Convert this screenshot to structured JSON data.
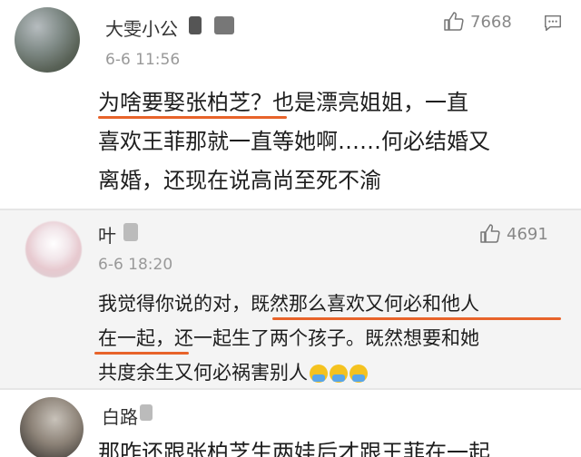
{
  "comments": [
    {
      "username": "大雯小公",
      "time": "6-6 11:56",
      "likes": "7668",
      "lines": [
        "为啥要娶张柏芝？也是漂亮姐姐，一直",
        "喜欢王菲那就一直等她啊……何必结婚又",
        "离婚，还现在说高尚至死不渝"
      ]
    },
    {
      "username": "叶",
      "time": "6-6 18:20",
      "likes": "4691",
      "lines": [
        "我觉得你说的对，既然那么喜欢又何必和他人",
        "在一起，还一起生了两个孩子。既然想要和她",
        "共度余生又何必祸害别人"
      ]
    },
    {
      "username": "白路",
      "lines": [
        "那咋还跟张柏芝生两娃后才跟王菲在一起"
      ]
    }
  ],
  "colors": {
    "underline": "#e8632a",
    "meta": "#999999",
    "like": "#888888"
  },
  "icons": {
    "like": "thumbs-up-icon",
    "reply": "reply-icon",
    "emoji": "emoji-icon"
  }
}
